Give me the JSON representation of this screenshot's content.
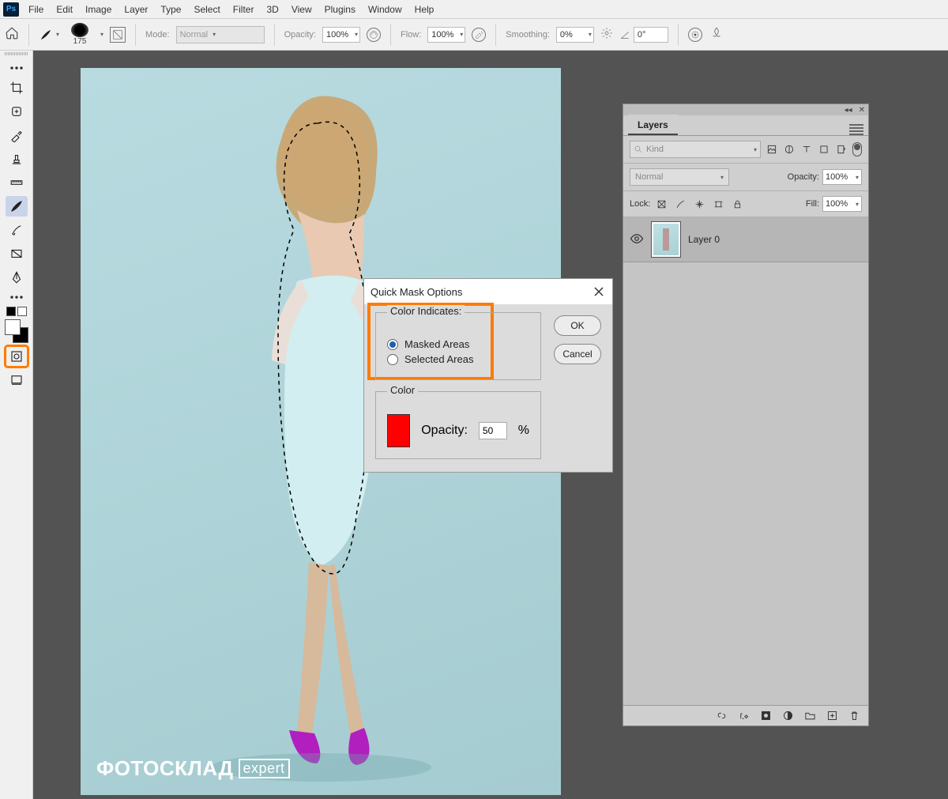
{
  "app": {
    "logo_text": "Ps"
  },
  "menubar": {
    "items": [
      "File",
      "Edit",
      "Image",
      "Layer",
      "Type",
      "Select",
      "Filter",
      "3D",
      "View",
      "Plugins",
      "Window",
      "Help"
    ]
  },
  "optionsbar": {
    "brush_size": "175",
    "mode_label": "Mode:",
    "mode_value": "Normal",
    "opacity_label": "Opacity:",
    "opacity_value": "100%",
    "flow_label": "Flow:",
    "flow_value": "100%",
    "smoothing_label": "Smoothing:",
    "smoothing_value": "0%",
    "angle_value": "0°"
  },
  "toolbar": {
    "tools": [
      "crop",
      "spot-heal",
      "eyedropper",
      "stamp",
      "ruler",
      "brush",
      "paint",
      "gradient",
      "pen"
    ]
  },
  "canvas": {
    "watermark_main": "ФОТОСКЛАД",
    "watermark_suffix": "expert"
  },
  "quick_mask_dialog": {
    "title": "Quick Mask Options",
    "legend_color_indicates": "Color Indicates:",
    "radio_masked": "Masked Areas",
    "radio_selected": "Selected Areas",
    "legend_color": "Color",
    "opacity_label": "Opacity:",
    "opacity_value": "50",
    "opacity_unit": "%",
    "ok_label": "OK",
    "cancel_label": "Cancel",
    "color_swatch_hex": "#ff0000"
  },
  "layers_panel": {
    "tab_label": "Layers",
    "kind_placeholder": "Kind",
    "blend_mode": "Normal",
    "opacity_label": "Opacity:",
    "opacity_value": "100%",
    "lock_label": "Lock:",
    "fill_label": "Fill:",
    "fill_value": "100%",
    "layers": [
      {
        "name": "Layer 0"
      }
    ]
  }
}
